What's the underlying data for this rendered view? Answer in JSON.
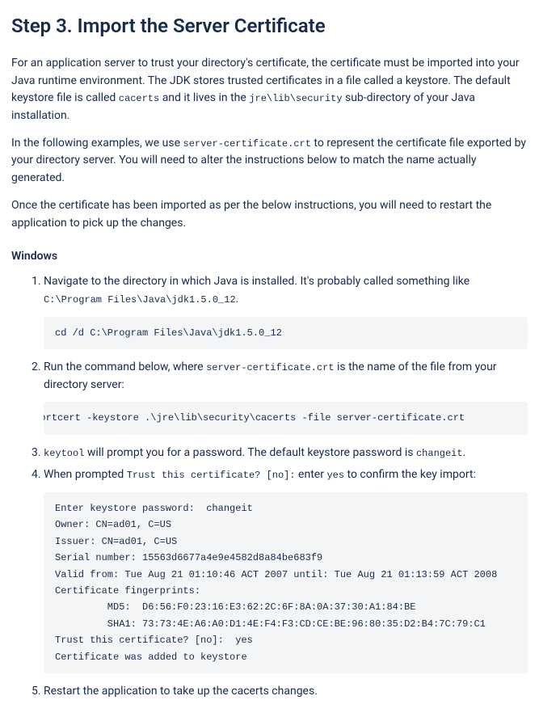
{
  "heading": "Step 3. Import the Server Certificate",
  "para1": {
    "text1": "For an application server to trust your directory's certificate, the certificate must be imported into your Java runtime environment. The JDK stores trusted certificates in a file called a keystore. The default keystore file is called ",
    "code1": "cacerts",
    "text2": " and it lives in the ",
    "code2": "jre\\lib\\security",
    "text3": " sub-directory of your Java installation."
  },
  "para2": {
    "text1": "In the following examples, we use ",
    "code1": "server-certificate.crt",
    "text2": " to represent the certificate file exported by your directory server. You will need to alter the instructions below to match the name actually generated."
  },
  "para3": "Once the certificate has been imported as per the below instructions, you will need to restart the application to pick up the changes.",
  "subheading": "Windows",
  "step1": {
    "text1": "Navigate to the directory in which Java is installed. It's probably called something like ",
    "code1": "C:\\Program Files\\Java\\jdk1.5.0_12",
    "text2": "."
  },
  "code_block1": "cd /d C:\\Program Files\\Java\\jdk1.5.0_12",
  "step2": {
    "text1": "Run the command below, where ",
    "code1": "server-certificate.crt",
    "text2": " is the name of the file from your directory server:"
  },
  "code_block2": "keytool -importcert -keystore .\\jre\\lib\\security\\cacerts -file server-certificate.crt",
  "step3": {
    "code1": "keytool",
    "text1": " will prompt you for a password. The default keystore password is ",
    "code2": "changeit",
    "text2": "."
  },
  "step4": {
    "text1": "When prompted ",
    "code1": "Trust this certificate? [no]:",
    "text2": " enter ",
    "code2": "yes",
    "text3": " to confirm the key import:"
  },
  "code_block3": "Enter keystore password:  changeit\nOwner: CN=ad01, C=US\nIssuer: CN=ad01, C=US\nSerial number: 15563d6677a4e9e4582d8a84be683f9\nValid from: Tue Aug 21 01:10:46 ACT 2007 until: Tue Aug 21 01:13:59 ACT 2008\nCertificate fingerprints:\n         MD5:  D6:56:F0:23:16:E3:62:2C:6F:8A:0A:37:30:A1:84:BE\n         SHA1: 73:73:4E:A6:A0:D1:4E:F4:F3:CD:CE:BE:96:80:35:D2:B4:7C:79:C1\nTrust this certificate? [no]:  yes\nCertificate was added to keystore",
  "step5": "Restart the application to take up the cacerts changes."
}
